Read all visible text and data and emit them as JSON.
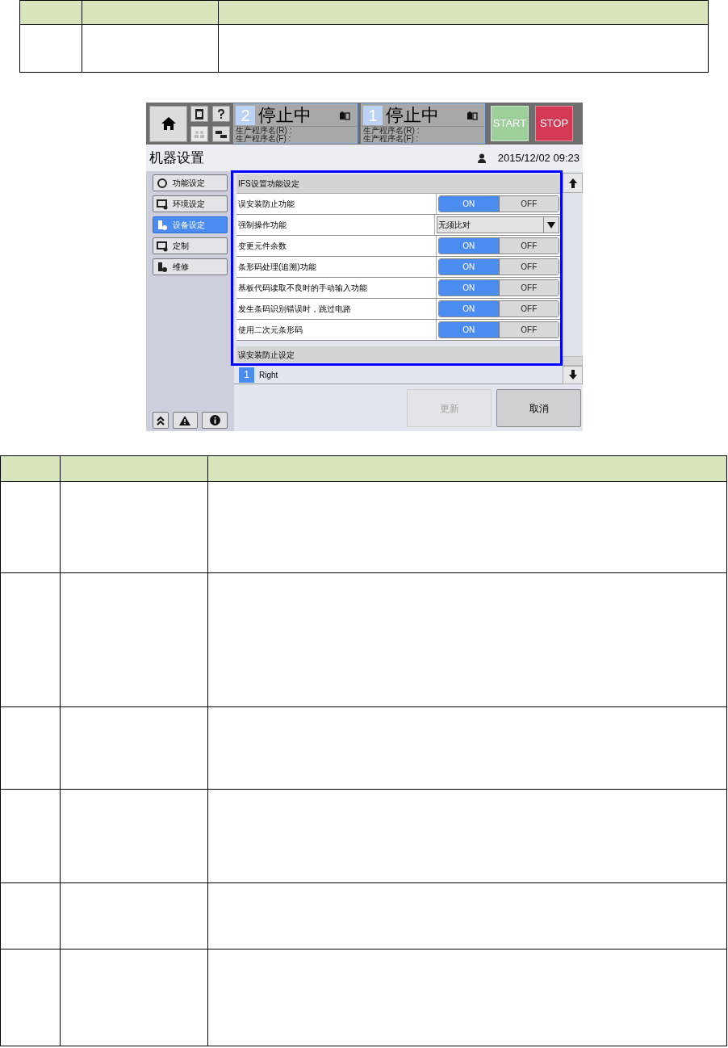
{
  "screen": {
    "machines": [
      {
        "number": "2",
        "status": "停止中",
        "lines": [
          "生产程序名(R) :",
          "生产程序名(F) :"
        ]
      },
      {
        "number": "1",
        "status": "停止中",
        "lines": [
          "生产程序名(R) :",
          "生产程序名(F) :"
        ]
      }
    ],
    "start_button": "START",
    "stop_button": "STOP",
    "title": "机器设置",
    "datetime": "2015/12/02 09:23",
    "sidebar": {
      "items": [
        {
          "label": "功能设定",
          "selected": false
        },
        {
          "label": "环境设定",
          "selected": false
        },
        {
          "label": "设备设定",
          "selected": true
        },
        {
          "label": "定制",
          "selected": false
        },
        {
          "label": "维修",
          "selected": false
        }
      ]
    },
    "settings": {
      "header": "IFS设置功能设定",
      "rows": [
        {
          "kind": "toggle",
          "label": "误安装防止功能",
          "options": [
            {
              "label": "ON",
              "selected": true
            },
            {
              "label": "OFF",
              "selected": false
            }
          ]
        },
        {
          "kind": "select",
          "label": "强制操作功能",
          "value": "无须比对"
        },
        {
          "kind": "toggle",
          "label": "变更元件余数",
          "options": [
            {
              "label": "ON",
              "selected": true
            },
            {
              "label": "OFF",
              "selected": false
            }
          ]
        },
        {
          "kind": "toggle",
          "label": "条形码处理(追溯)功能",
          "options": [
            {
              "label": "ON",
              "selected": true
            },
            {
              "label": "OFF",
              "selected": false
            }
          ]
        },
        {
          "kind": "toggle",
          "label": "基板代码读取不良时的手动输入功能",
          "options": [
            {
              "label": "ON",
              "selected": true
            },
            {
              "label": "OFF",
              "selected": false
            }
          ]
        },
        {
          "kind": "toggle",
          "label": "发生条码识别错误时，跳过电路",
          "options": [
            {
              "label": "ON",
              "selected": true
            },
            {
              "label": "OFF",
              "selected": false
            }
          ]
        },
        {
          "kind": "toggle",
          "label": "使用二次元条形码",
          "options": [
            {
              "label": "ON",
              "selected": true
            },
            {
              "label": "OFF",
              "selected": false
            }
          ]
        }
      ],
      "section": "误安装防止设定"
    },
    "lane": {
      "badge": "1",
      "label": "Right"
    },
    "update_button": {
      "label": "更新",
      "disabled": true
    },
    "cancel_button": {
      "label": "取消",
      "disabled": false
    }
  }
}
